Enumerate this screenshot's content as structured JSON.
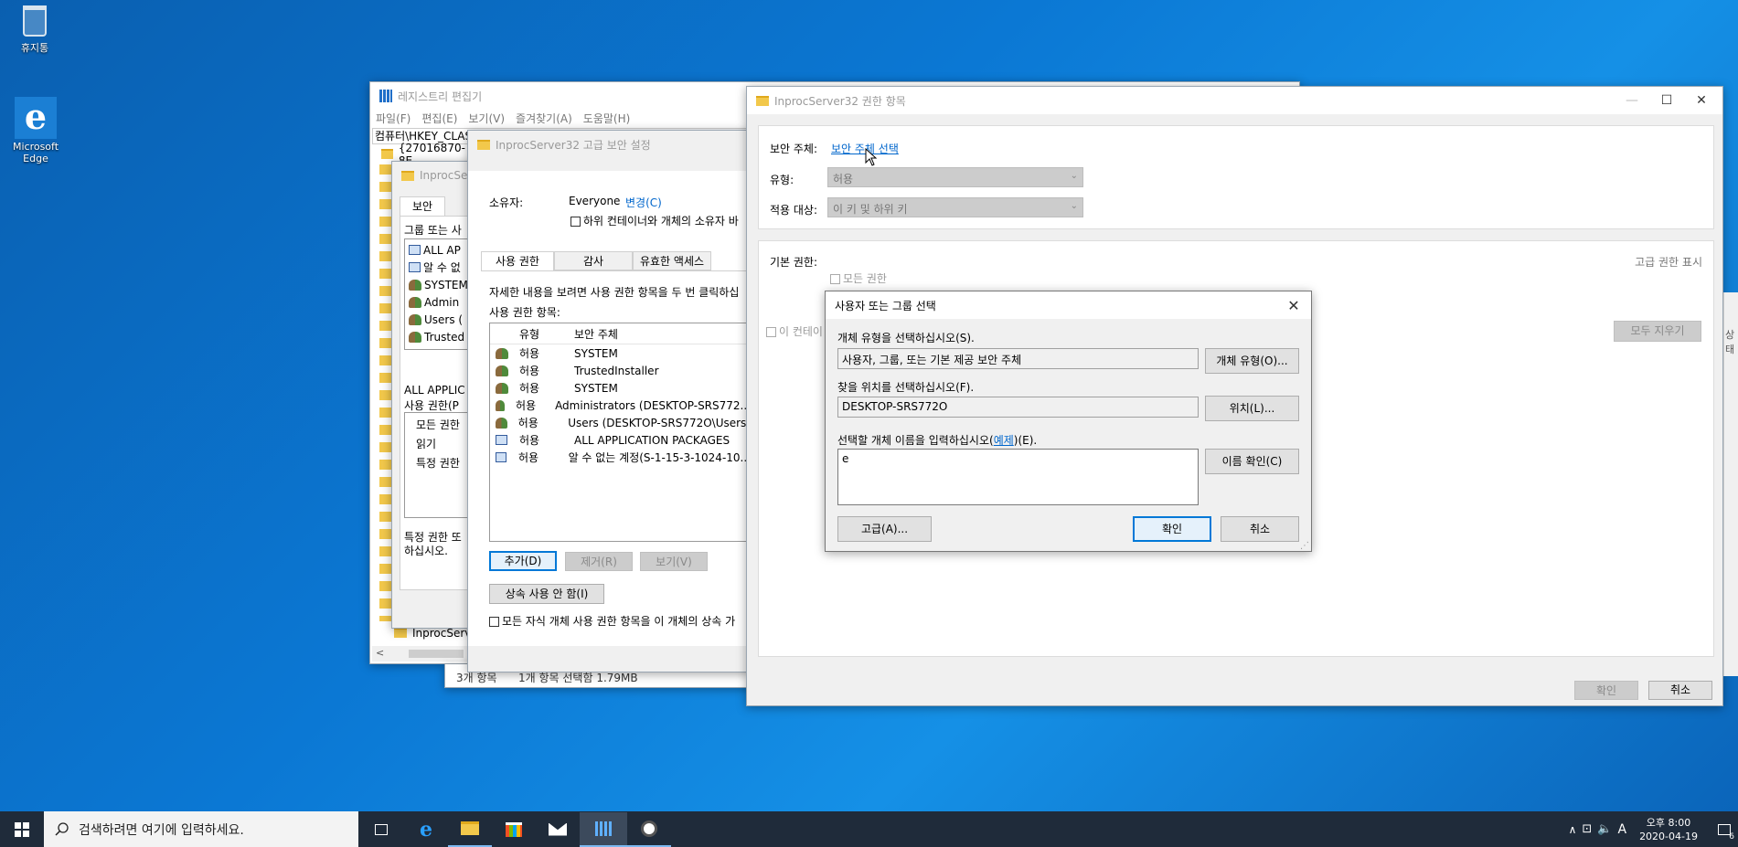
{
  "desktop": {
    "icons": [
      {
        "label": "휴지통"
      },
      {
        "label": "Microsoft Edge"
      }
    ]
  },
  "registry": {
    "title": "레지스트리 편집기",
    "menu": [
      "파일(F)",
      "편집(E)",
      "보기(V)",
      "즐겨찾기(A)",
      "도움말(H)"
    ],
    "address": "컴퓨터\\HKEY_CLAS",
    "tree_item_top": "{27016870-8E",
    "tree_item_bottom": "InprocServe"
  },
  "basic_perm": {
    "title": "InprocServ",
    "tab": "보안",
    "group_label": "그룹 또는 사",
    "groups": [
      "ALL AP",
      "알 수 없",
      "SYSTEM",
      "Admin",
      "Users (",
      "Trusted"
    ],
    "perm_for": "ALL APPLIC",
    "perm_label": "사용 권한(P",
    "perms": [
      "모든 권한",
      "읽기",
      "특정 권한"
    ],
    "special_note_1": "특정 권한 또",
    "special_note_2": "하십시오."
  },
  "advanced": {
    "title": "InprocServer32 고급 보안 설정",
    "owner_label": "소유자:",
    "owner_value": "Everyone",
    "owner_change": "변경(C)",
    "owner_replace": "하위 컨테이너와 개체의 소유자 바",
    "tabs": [
      "사용 권한",
      "감사",
      "유효한 액세스"
    ],
    "desc": "자세한 내용을 보려면 사용 권한 항목을 두 번 클릭하십",
    "entries_label": "사용 권한 항목:",
    "col_type": "유형",
    "col_principal": "보안 주체",
    "entries": [
      {
        "type": "허용",
        "principal": "SYSTEM",
        "icon": "user-icon"
      },
      {
        "type": "허용",
        "principal": "TrustedInstaller",
        "icon": "user-icon"
      },
      {
        "type": "허용",
        "principal": "SYSTEM",
        "icon": "user-icon"
      },
      {
        "type": "허용",
        "principal": "Administrators (DESKTOP-SRS772...",
        "icon": "user-icon"
      },
      {
        "type": "허용",
        "principal": "Users (DESKTOP-SRS772O\\Users)",
        "icon": "user-icon"
      },
      {
        "type": "허용",
        "principal": "ALL APPLICATION PACKAGES",
        "icon": "package-icon"
      },
      {
        "type": "허용",
        "principal": "알 수 없는 계정(S-1-15-3-1024-10...",
        "icon": "package-icon"
      }
    ],
    "add_btn": "추가(D)",
    "remove_btn": "제거(R)",
    "view_btn": "보기(V)",
    "disable_inherit_btn": "상속 사용 안 함(I)",
    "replace_child": "모든 자식 개체 사용 권한 항목을 이 개체의 상속 가"
  },
  "explorer_status": {
    "count": "3개 항목",
    "selected": "1개 항목 선택함 1.79MB"
  },
  "perm_entry": {
    "title": "InprocServer32 권한 항목",
    "principal_label": "보안 주체:",
    "principal_link": "보안 주체 선택",
    "type_label": "유형:",
    "type_value": "허용",
    "applies_label": "적용 대상:",
    "applies_value": "이 키 및 하위 키",
    "basic_label": "기본 권한:",
    "show_advanced": "고급 권한 표시",
    "full_control": "모든 권한",
    "container_only": "이 컨테이",
    "clear_all": "모두 지우기",
    "ok": "확인",
    "cancel": "취소",
    "edge_fragment": "상태"
  },
  "select_dialog": {
    "title": "사용자 또는 그룹 선택",
    "obj_type_label": "개체 유형을 선택하십시오(S).",
    "obj_type_value": "사용자, 그룹, 또는 기본 제공 보안 주체",
    "obj_type_btn": "개체 유형(O)...",
    "location_label": "찾을 위치를 선택하십시오(F).",
    "location_value": "DESKTOP-SRS772O",
    "location_btn": "위치(L)...",
    "name_label_pre": "선택할 개체 이름을 입력하십시오(",
    "name_label_link": "예제",
    "name_label_post": ")(E).",
    "name_value": "e",
    "check_names_btn": "이름 확인(C)",
    "advanced_btn": "고급(A)...",
    "ok_btn": "확인",
    "cancel_btn": "취소"
  },
  "taskbar": {
    "search_placeholder": "검색하려면 여기에 입력하세요.",
    "ime": "A",
    "time": "오후 8:00",
    "date": "2020-04-19",
    "notification_count": "6"
  }
}
